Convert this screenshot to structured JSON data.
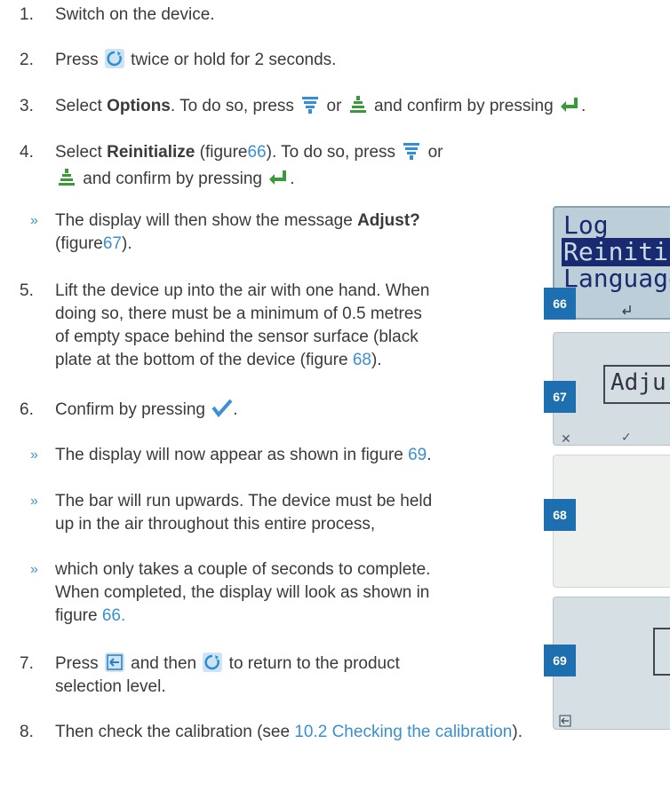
{
  "steps": [
    {
      "num": "1.",
      "text": "Switch on the device."
    },
    {
      "num": "2.",
      "pre": "Press",
      "post": "twice or hold for 2 seconds."
    },
    {
      "num": "3.",
      "pre": "Select",
      "bold": "Options",
      "mid": ". To do so, press",
      "or": "or",
      "post": "and confirm by pressing",
      "end": "."
    },
    {
      "num": "4.",
      "pre": "Select",
      "bold": "Reinitialize",
      "fig_pre": "(figure",
      "fig_ref": "66",
      "fig_post": "). To do so, press",
      "or": "or",
      "line2_post": "and confirm by pressing",
      "end": "."
    },
    {
      "num": "5.",
      "lines": [
        "Lift the device up into the air with one hand. When",
        "doing so, there must be a minimum of 0.5 metres",
        "of empty space behind the sensor surface (black"
      ],
      "last_pre": "plate at the bottom of the device (figure",
      "fig_ref": "68",
      "last_post": ")."
    },
    {
      "num": "6.",
      "pre": "Confirm by pressing",
      "end": "."
    },
    {
      "num": "7.",
      "pre": "Press",
      "mid": "and then",
      "post": "to return to the product",
      "line2": "selection level."
    },
    {
      "num": "8.",
      "pre": "Then check the calibration (see",
      "link": "10.2 Checking the calibration",
      "post": ")."
    }
  ],
  "notes": {
    "adjust": {
      "pre": "The display will then show the message",
      "bold": "Adjust?",
      "line2_pre": "(figure",
      "fig_ref": "67",
      "line2_post": ")."
    },
    "fig69": {
      "pre": "The display will now appear as shown in figure",
      "fig_ref": "69",
      "end": "."
    },
    "bar": {
      "line1": "The bar will run upwards. The device must be held",
      "line2": "up in the air throughout this entire process,"
    },
    "complete": {
      "line1": "which only takes a couple of seconds to complete.",
      "line2": "When completed, the display will look as shown in",
      "line3_pre": "figure",
      "fig_ref": "66",
      "end": "."
    }
  },
  "bullet_glyph": "»",
  "figures": [
    {
      "num": "66",
      "lines": [
        "Log Time",
        "Reinitiali",
        "Language"
      ]
    },
    {
      "num": "67",
      "text": "Adju"
    },
    {
      "num": "68"
    },
    {
      "num": "69"
    }
  ],
  "colors": {
    "link": "#3b8fd0",
    "tag": "#1e6fb0",
    "lcd": "#c9dbe3",
    "text": "#3a3a3a"
  },
  "icons": [
    "power-mode-icon",
    "arrow-down-icon",
    "arrow-up-icon",
    "enter-icon",
    "checkmark-icon",
    "back-icon"
  ]
}
